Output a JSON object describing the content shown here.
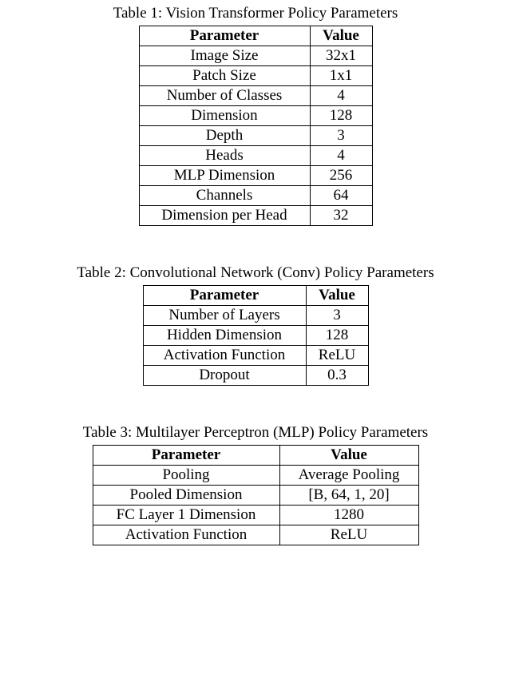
{
  "tables": [
    {
      "caption": "Table 1: Vision Transformer Policy Parameters",
      "header": {
        "param": "Parameter",
        "value": "Value"
      },
      "rows": [
        {
          "param": "Image Size",
          "value": "32x1"
        },
        {
          "param": "Patch Size",
          "value": "1x1"
        },
        {
          "param": "Number of Classes",
          "value": "4"
        },
        {
          "param": "Dimension",
          "value": "128"
        },
        {
          "param": "Depth",
          "value": "3"
        },
        {
          "param": "Heads",
          "value": "4"
        },
        {
          "param": "MLP Dimension",
          "value": "256"
        },
        {
          "param": "Channels",
          "value": "64"
        },
        {
          "param": "Dimension per Head",
          "value": "32"
        }
      ]
    },
    {
      "caption": "Table 2: Convolutional Network (Conv) Policy Parameters",
      "header": {
        "param": "Parameter",
        "value": "Value"
      },
      "rows": [
        {
          "param": "Number of Layers",
          "value": "3"
        },
        {
          "param": "Hidden Dimension",
          "value": "128"
        },
        {
          "param": "Activation Function",
          "value": "ReLU"
        },
        {
          "param": "Dropout",
          "value": "0.3"
        }
      ]
    },
    {
      "caption": "Table 3: Multilayer Perceptron (MLP) Policy Parameters",
      "header": {
        "param": "Parameter",
        "value": "Value"
      },
      "rows": [
        {
          "param": "Pooling",
          "value": "Average Pooling"
        },
        {
          "param": "Pooled Dimension",
          "value": "[B, 64, 1, 20]"
        },
        {
          "param": "FC Layer 1 Dimension",
          "value": "1280"
        },
        {
          "param": "Activation Function",
          "value": "ReLU"
        }
      ]
    }
  ]
}
